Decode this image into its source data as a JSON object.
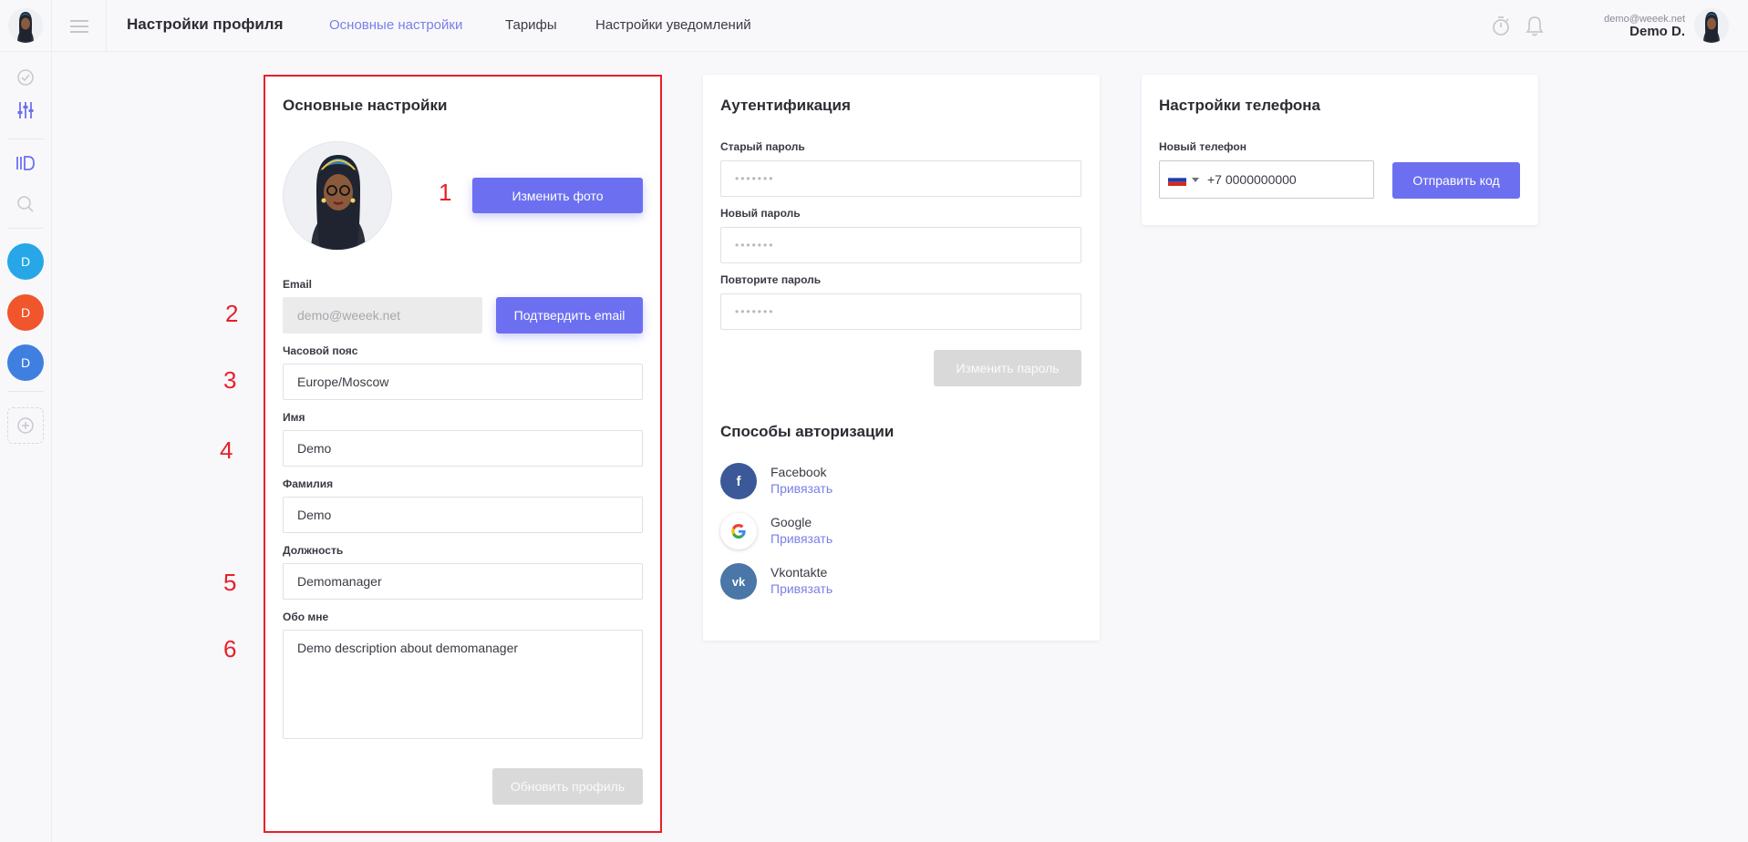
{
  "header": {
    "title": "Настройки профиля",
    "tabs": [
      {
        "label": "Основные настройки",
        "active": true
      },
      {
        "label": "Тарифы",
        "active": false
      },
      {
        "label": "Настройки уведомлений",
        "active": false
      }
    ],
    "user_email": "demo@weeek.net",
    "user_name": "Demo D."
  },
  "sidebar": {
    "workspaces": [
      {
        "letter": "D",
        "color": "#27a7e7"
      },
      {
        "letter": "D",
        "color": "#f1552b"
      },
      {
        "letter": "D",
        "color": "#3f7fe0"
      }
    ]
  },
  "basic": {
    "title": "Основные настройки",
    "change_photo": "Изменить фото",
    "email_label": "Email",
    "email_value": "demo@weeek.net",
    "confirm_email": "Подтвердить email",
    "tz_label": "Часовой пояс",
    "tz_value": "Europe/Moscow",
    "name_label": "Имя",
    "name_value": "Demo",
    "surname_label": "Фамилия",
    "surname_value": "Demo",
    "position_label": "Должность",
    "position_value": "Demomanager",
    "about_label": "Обо мне",
    "about_value": "Demo description about demomanager",
    "update_profile": "Обновить профиль"
  },
  "auth": {
    "title": "Аутентификация",
    "old_label": "Старый пароль",
    "old_placeholder": "•••••••",
    "new_label": "Новый пароль",
    "new_placeholder": "•••••••",
    "repeat_label": "Повторите пароль",
    "repeat_placeholder": "•••••••",
    "change_password": "Изменить пароль",
    "methods_title": "Способы авторизации",
    "methods": [
      {
        "name": "Facebook",
        "link": "Привязать",
        "icon": "facebook-icon",
        "color": "#3b5998"
      },
      {
        "name": "Google",
        "link": "Привязать",
        "icon": "google-icon",
        "color": "#ffffff"
      },
      {
        "name": "Vkontakte",
        "link": "Привязать",
        "icon": "vk-icon",
        "color": "#4a76a8"
      }
    ]
  },
  "phone": {
    "title": "Настройки телефона",
    "label": "Новый телефон",
    "value": "+7 0000000000",
    "send_code": "Отправить код"
  },
  "annotations": [
    "1",
    "2",
    "3",
    "4",
    "5",
    "6"
  ]
}
